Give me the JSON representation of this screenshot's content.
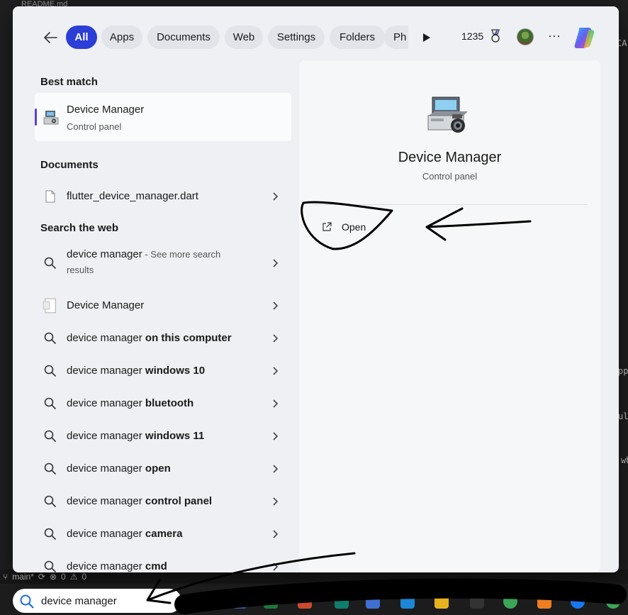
{
  "editor": {
    "tab_title": "README.md",
    "right_fragments": [
      "CA",
      "pp",
      "ul",
      "wh"
    ],
    "status": {
      "branch": "main*",
      "errors": "0",
      "warnings": "0"
    }
  },
  "filters": {
    "items": [
      {
        "label": "All",
        "active": true
      },
      {
        "label": "Apps"
      },
      {
        "label": "Documents"
      },
      {
        "label": "Web"
      },
      {
        "label": "Settings"
      },
      {
        "label": "Folders"
      },
      {
        "label": "Ph"
      }
    ],
    "points": "1235"
  },
  "results": {
    "best_match_label": "Best match",
    "best_match": {
      "title": "Device Manager",
      "subtitle": "Control panel"
    },
    "documents_label": "Documents",
    "documents": [
      {
        "name": "flutter_device_manager.dart"
      }
    ],
    "web_label": "Search the web",
    "web_first": {
      "query": "device manager",
      "more": " - See more search results"
    },
    "app_item": {
      "name": "Device Manager"
    },
    "web_items": [
      {
        "prefix": "device manager",
        "suffix": " on this computer"
      },
      {
        "prefix": "device manager",
        "suffix": " windows 10"
      },
      {
        "prefix": "device manager",
        "suffix": " bluetooth"
      },
      {
        "prefix": "device manager",
        "suffix": " windows 11"
      },
      {
        "prefix": "device manager",
        "suffix": " open"
      },
      {
        "prefix": "device manager",
        "suffix": " control panel"
      },
      {
        "prefix": "device manager",
        "suffix": " camera"
      },
      {
        "prefix": "device manager",
        "suffix": " cmd"
      }
    ]
  },
  "preview": {
    "title": "Device Manager",
    "subtitle": "Control panel",
    "action_open": "Open"
  },
  "taskbar": {
    "search_value": "device manager"
  },
  "colors": {
    "accent": "#2b3ed6",
    "selection_bar": "#5b3fd8",
    "flyout_bg": "#eef0f4"
  }
}
